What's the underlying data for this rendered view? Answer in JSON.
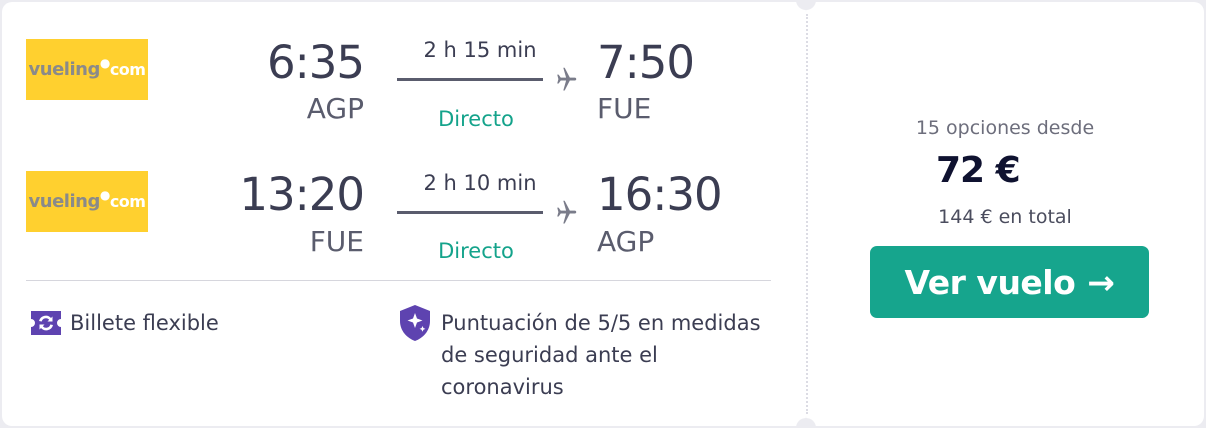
{
  "flights": [
    {
      "airline_logo": {
        "brand": "vueling",
        "dot": "●",
        "suffix": "com"
      },
      "dep_time": "6:35",
      "dep_code": "AGP",
      "duration": "2 h 15 min",
      "stops": "Directo",
      "arr_time": "7:50",
      "arr_code": "FUE"
    },
    {
      "airline_logo": {
        "brand": "vueling",
        "dot": "●",
        "suffix": "com"
      },
      "dep_time": "13:20",
      "dep_code": "FUE",
      "duration": "2 h 10 min",
      "stops": "Directo",
      "arr_time": "16:30",
      "arr_code": "AGP"
    }
  ],
  "features": {
    "flexible": {
      "icon": "flexible-ticket-icon",
      "label": "Billete flexible"
    },
    "safety": {
      "icon": "shield-sparkle-icon",
      "lines": [
        "Puntuación de 5/5 en medidas",
        "de seguridad ante el",
        "coronavirus"
      ]
    }
  },
  "pricing": {
    "options_text": "15 opciones desde",
    "price": "72 €",
    "total_text": "144 € en total",
    "cta_label": "Ver vuelo",
    "cta_arrow": "→"
  },
  "colors": {
    "accent_green": "#16a58d",
    "stops_green": "#14a38b",
    "vueling_yellow": "#ffd02f",
    "feature_purple": "#5e43b0",
    "text_dark": "#3b3d52"
  }
}
